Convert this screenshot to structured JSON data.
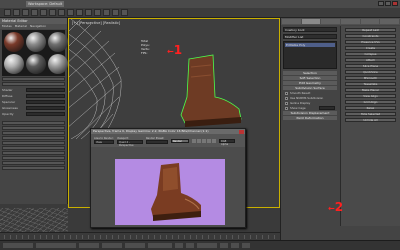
{
  "window": {
    "title": "Workspace: Default"
  },
  "material_editor": {
    "title": "Material Editor",
    "menu": [
      "Modes",
      "Material",
      "Navigation",
      "Options",
      "Utilities"
    ],
    "sphere_colors": [
      "#7a3a2a",
      "#8a8a8a",
      "#6e6e6e",
      "#b0b0b0",
      "#5a5a5a",
      "#9a9a9a"
    ],
    "params": [
      {
        "label": "Shader"
      },
      {
        "label": "Diffuse"
      },
      {
        "label": "Specular"
      },
      {
        "label": "Glossiness"
      },
      {
        "label": "Opacity"
      }
    ]
  },
  "viewport": {
    "label": "[+] [Perspective] [Realistic]",
    "stats": [
      "Total",
      "Polys:",
      "Verts:",
      "FPS:"
    ],
    "annotation": "1"
  },
  "render_window": {
    "title": "Perspective, frame 0, Display Gamma: 2.2, RGBA Color 16 Bits/Channel (1:1)",
    "area_label": "Area to Render:",
    "area_value": "View",
    "viewport_label": "Viewport:",
    "viewport_value": "Quad 4 - Perspective",
    "preset_label": "Render Preset:",
    "channel_value": "RGB Alpha",
    "render_button": "Render"
  },
  "command_panel": {
    "object_name": "Cowboy boot",
    "modifier_list_label": "Modifier List",
    "modifier_items": [
      "Editable Poly"
    ],
    "rollouts": [
      "Selection",
      "Soft Selection",
      "Edit Geometry",
      "Subdivision Surface",
      "Subdivision Displacement",
      "Paint Deformation"
    ],
    "subdiv_rows": [
      "Smooth Result",
      "Use NURMS Subdivision",
      "Isoline Display",
      "Show Cage"
    ],
    "right_buttons": [
      "Repeat Last",
      "Constraints",
      "Preserve UVs",
      "Create",
      "Collapse",
      "Attach",
      "Slice Plane",
      "QuickSlice",
      "MSmooth",
      "Tessellate",
      "Make Planar",
      "View Align",
      "Grid Align",
      "Relax",
      "Hide Selected",
      "Unhide All"
    ],
    "annotation": "2"
  }
}
